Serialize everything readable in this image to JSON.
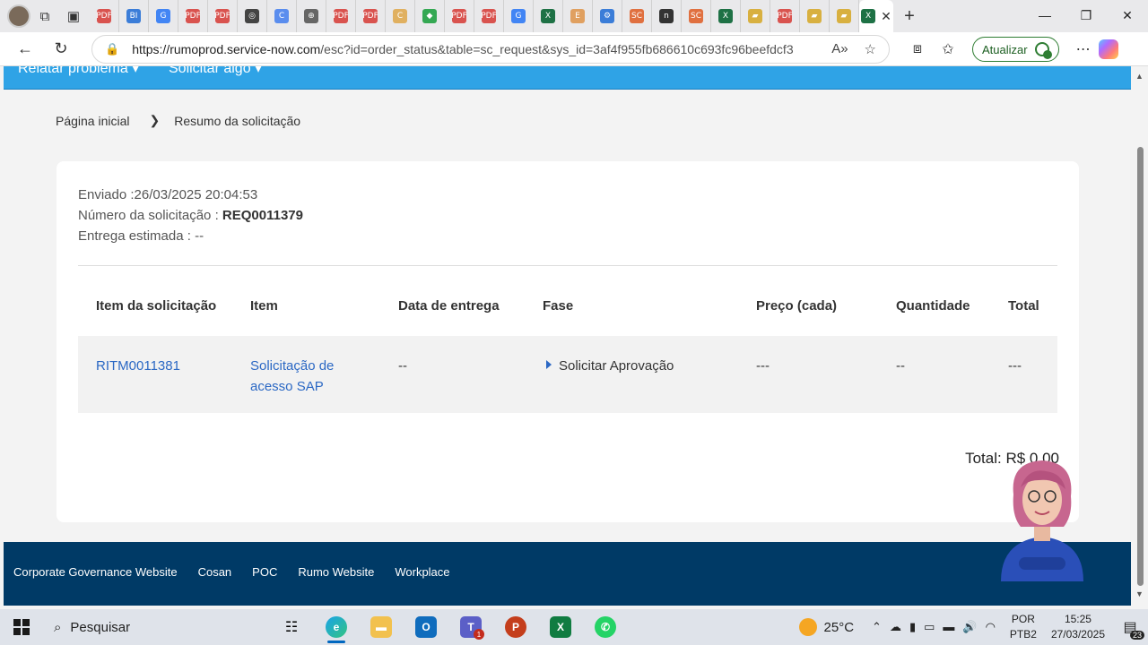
{
  "browser": {
    "tabs": [
      {
        "icon": "profile-avatar"
      },
      {
        "icon": "workspaces-icon"
      },
      {
        "icon": "tab-actions-icon"
      },
      {
        "label": "PDF",
        "color": "#d9534f"
      },
      {
        "label": "BI",
        "color": "#3b7dd8"
      },
      {
        "label": "G",
        "color": "#4285f4"
      },
      {
        "label": "PDF",
        "color": "#d9534f"
      },
      {
        "label": "PDF",
        "color": "#d9534f"
      },
      {
        "label": "◎",
        "color": "#444444"
      },
      {
        "label": "C",
        "color": "#5a8dee"
      },
      {
        "label": "⊕",
        "color": "#666666"
      },
      {
        "label": "PDF",
        "color": "#d9534f"
      },
      {
        "label": "PDF",
        "color": "#d9534f"
      },
      {
        "label": "C",
        "color": "#e0b060"
      },
      {
        "label": "◆",
        "color": "#34a853"
      },
      {
        "label": "PDF",
        "color": "#d9534f"
      },
      {
        "label": "PDF",
        "color": "#d9534f"
      },
      {
        "label": "G",
        "color": "#4285f4"
      },
      {
        "label": "X",
        "color": "#1e7145"
      },
      {
        "label": "E",
        "color": "#e0a060"
      },
      {
        "label": "⚙",
        "color": "#3b7dd8"
      },
      {
        "label": "SC",
        "color": "#e07040"
      },
      {
        "label": "n",
        "color": "#333333"
      },
      {
        "label": "SC",
        "color": "#e07040"
      },
      {
        "label": "X",
        "color": "#1e7145"
      },
      {
        "label": "▰",
        "color": "#d8b040"
      },
      {
        "label": "PDF",
        "color": "#d9534f"
      },
      {
        "label": "▰",
        "color": "#d8b040"
      },
      {
        "label": "▰",
        "color": "#d8b040"
      },
      {
        "label": "X",
        "color": "#1e7145",
        "active": true
      }
    ],
    "window_controls": {
      "minimize": "—",
      "restore": "❐",
      "close": "✕"
    },
    "new_tab": "+",
    "url_host": "https://rumoprod.service-now.com",
    "url_path": "/esc?id=order_status&table=sc_request&sys_id=3af4f955fb686610c693fc96beefdcf3",
    "update_label": "Atualizar"
  },
  "page": {
    "topnav": [
      "Relatar problema",
      "Solicitar algo"
    ],
    "breadcrumb": {
      "home": "Página inicial",
      "current": "Resumo da solicitação"
    },
    "meta": {
      "sent_label": "Enviado :",
      "sent_value": "26/03/2025 20:04:53",
      "number_label": "Número da solicitação :",
      "number_value": "REQ0011379",
      "delivery_label": "Entrega estimada :",
      "delivery_value": "--"
    },
    "table": {
      "headers": [
        "Item da solicitação",
        "Item",
        "Data de entrega",
        "Fase",
        "Preço (cada)",
        "Quantidade",
        "Total"
      ],
      "row": {
        "ritm": "RITM0011381",
        "item_line1": "Solicitação de",
        "item_line2": "acesso SAP",
        "delivery": "--",
        "stage": "Solicitar Aprovação",
        "price": "---",
        "quantity": "--",
        "total": "---"
      }
    },
    "total": "Total: R$ 0,00",
    "footer_links": [
      "Corporate Governance Website",
      "Cosan",
      "POC",
      "Rumo Website",
      "Workplace"
    ]
  },
  "taskbar": {
    "search_label": "Pesquisar",
    "weather": "25°C",
    "lang_line1": "POR",
    "lang_line2": "PTB2",
    "time": "15:25",
    "date": "27/03/2025",
    "notifications": "23",
    "teams_badge": "1"
  }
}
